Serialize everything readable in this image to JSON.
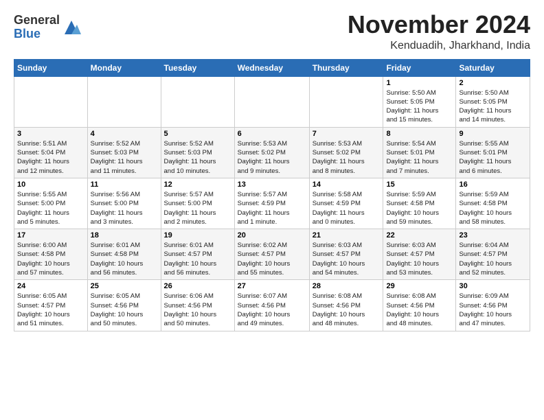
{
  "header": {
    "logo_general": "General",
    "logo_blue": "Blue",
    "month": "November 2024",
    "location": "Kenduadih, Jharkhand, India"
  },
  "weekdays": [
    "Sunday",
    "Monday",
    "Tuesday",
    "Wednesday",
    "Thursday",
    "Friday",
    "Saturday"
  ],
  "weeks": [
    [
      {
        "day": "",
        "info": ""
      },
      {
        "day": "",
        "info": ""
      },
      {
        "day": "",
        "info": ""
      },
      {
        "day": "",
        "info": ""
      },
      {
        "day": "",
        "info": ""
      },
      {
        "day": "1",
        "info": "Sunrise: 5:50 AM\nSunset: 5:05 PM\nDaylight: 11 hours\nand 15 minutes."
      },
      {
        "day": "2",
        "info": "Sunrise: 5:50 AM\nSunset: 5:05 PM\nDaylight: 11 hours\nand 14 minutes."
      }
    ],
    [
      {
        "day": "3",
        "info": "Sunrise: 5:51 AM\nSunset: 5:04 PM\nDaylight: 11 hours\nand 12 minutes."
      },
      {
        "day": "4",
        "info": "Sunrise: 5:52 AM\nSunset: 5:03 PM\nDaylight: 11 hours\nand 11 minutes."
      },
      {
        "day": "5",
        "info": "Sunrise: 5:52 AM\nSunset: 5:03 PM\nDaylight: 11 hours\nand 10 minutes."
      },
      {
        "day": "6",
        "info": "Sunrise: 5:53 AM\nSunset: 5:02 PM\nDaylight: 11 hours\nand 9 minutes."
      },
      {
        "day": "7",
        "info": "Sunrise: 5:53 AM\nSunset: 5:02 PM\nDaylight: 11 hours\nand 8 minutes."
      },
      {
        "day": "8",
        "info": "Sunrise: 5:54 AM\nSunset: 5:01 PM\nDaylight: 11 hours\nand 7 minutes."
      },
      {
        "day": "9",
        "info": "Sunrise: 5:55 AM\nSunset: 5:01 PM\nDaylight: 11 hours\nand 6 minutes."
      }
    ],
    [
      {
        "day": "10",
        "info": "Sunrise: 5:55 AM\nSunset: 5:00 PM\nDaylight: 11 hours\nand 5 minutes."
      },
      {
        "day": "11",
        "info": "Sunrise: 5:56 AM\nSunset: 5:00 PM\nDaylight: 11 hours\nand 3 minutes."
      },
      {
        "day": "12",
        "info": "Sunrise: 5:57 AM\nSunset: 5:00 PM\nDaylight: 11 hours\nand 2 minutes."
      },
      {
        "day": "13",
        "info": "Sunrise: 5:57 AM\nSunset: 4:59 PM\nDaylight: 11 hours\nand 1 minute."
      },
      {
        "day": "14",
        "info": "Sunrise: 5:58 AM\nSunset: 4:59 PM\nDaylight: 11 hours\nand 0 minutes."
      },
      {
        "day": "15",
        "info": "Sunrise: 5:59 AM\nSunset: 4:58 PM\nDaylight: 10 hours\nand 59 minutes."
      },
      {
        "day": "16",
        "info": "Sunrise: 5:59 AM\nSunset: 4:58 PM\nDaylight: 10 hours\nand 58 minutes."
      }
    ],
    [
      {
        "day": "17",
        "info": "Sunrise: 6:00 AM\nSunset: 4:58 PM\nDaylight: 10 hours\nand 57 minutes."
      },
      {
        "day": "18",
        "info": "Sunrise: 6:01 AM\nSunset: 4:58 PM\nDaylight: 10 hours\nand 56 minutes."
      },
      {
        "day": "19",
        "info": "Sunrise: 6:01 AM\nSunset: 4:57 PM\nDaylight: 10 hours\nand 56 minutes."
      },
      {
        "day": "20",
        "info": "Sunrise: 6:02 AM\nSunset: 4:57 PM\nDaylight: 10 hours\nand 55 minutes."
      },
      {
        "day": "21",
        "info": "Sunrise: 6:03 AM\nSunset: 4:57 PM\nDaylight: 10 hours\nand 54 minutes."
      },
      {
        "day": "22",
        "info": "Sunrise: 6:03 AM\nSunset: 4:57 PM\nDaylight: 10 hours\nand 53 minutes."
      },
      {
        "day": "23",
        "info": "Sunrise: 6:04 AM\nSunset: 4:57 PM\nDaylight: 10 hours\nand 52 minutes."
      }
    ],
    [
      {
        "day": "24",
        "info": "Sunrise: 6:05 AM\nSunset: 4:57 PM\nDaylight: 10 hours\nand 51 minutes."
      },
      {
        "day": "25",
        "info": "Sunrise: 6:05 AM\nSunset: 4:56 PM\nDaylight: 10 hours\nand 50 minutes."
      },
      {
        "day": "26",
        "info": "Sunrise: 6:06 AM\nSunset: 4:56 PM\nDaylight: 10 hours\nand 50 minutes."
      },
      {
        "day": "27",
        "info": "Sunrise: 6:07 AM\nSunset: 4:56 PM\nDaylight: 10 hours\nand 49 minutes."
      },
      {
        "day": "28",
        "info": "Sunrise: 6:08 AM\nSunset: 4:56 PM\nDaylight: 10 hours\nand 48 minutes."
      },
      {
        "day": "29",
        "info": "Sunrise: 6:08 AM\nSunset: 4:56 PM\nDaylight: 10 hours\nand 48 minutes."
      },
      {
        "day": "30",
        "info": "Sunrise: 6:09 AM\nSunset: 4:56 PM\nDaylight: 10 hours\nand 47 minutes."
      }
    ]
  ]
}
